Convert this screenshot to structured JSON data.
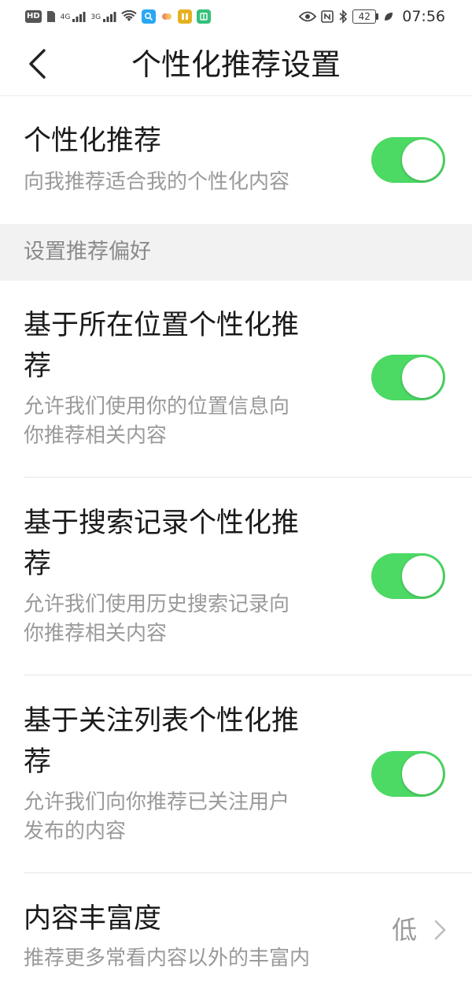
{
  "status_bar": {
    "left_badges": [
      "HD",
      "4G",
      "3G"
    ],
    "battery_level": "42",
    "time": "07:56",
    "accent_colors": {
      "app1": "#2aa7f2",
      "app2": "#f08a6b",
      "app3": "#e6b11e",
      "app4": "#35c07a"
    }
  },
  "header": {
    "title": "个性化推荐设置",
    "back_icon": "chevron-left-icon"
  },
  "personalized": {
    "title": "个性化推荐",
    "description": "向我推荐适合我的个性化内容",
    "enabled": true
  },
  "section": {
    "label": "设置推荐偏好"
  },
  "preferences": [
    {
      "title_line1": "基于所在位置个性化推",
      "title_line2": "荐",
      "desc_line1": "允许我们使用你的位置信息向",
      "desc_line2": "你推荐相关内容",
      "enabled": true
    },
    {
      "title_line1": "基于搜索记录个性化推",
      "title_line2": "荐",
      "desc_line1": "允许我们使用历史搜索记录向",
      "desc_line2": "你推荐相关内容",
      "enabled": true
    },
    {
      "title_line1": "基于关注列表个性化推",
      "title_line2": "荐",
      "desc_line1": "允许我们向你推荐已关注用户",
      "desc_line2": "发布的内容",
      "enabled": true
    }
  ],
  "richness": {
    "title": "内容丰富度",
    "value": "低",
    "description": "推荐更多常看内容以外的丰富内"
  },
  "theme": {
    "toggle_on": "#4cd964",
    "section_bg": "#f2f2f2",
    "secondary_text": "#9a9a9a"
  }
}
